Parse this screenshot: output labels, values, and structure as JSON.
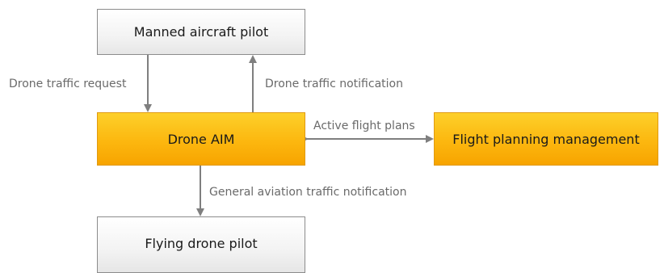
{
  "nodes": {
    "manned_pilot": "Manned aircraft pilot",
    "drone_aim": "Drone AIM",
    "flight_planning": "Flight planning management",
    "flying_drone_pilot": "Flying drone pilot"
  },
  "edges": {
    "drone_traffic_request": "Drone traffic request",
    "drone_traffic_notification": "Drone traffic notification",
    "active_flight_plans": "Active flight plans",
    "ga_traffic_notification": "General aviation traffic notification"
  },
  "colors": {
    "core_box": "#fcb70f",
    "external_box": "#f0f0f0",
    "connector": "#7f7f7f",
    "label_text": "#6a6a6a"
  }
}
